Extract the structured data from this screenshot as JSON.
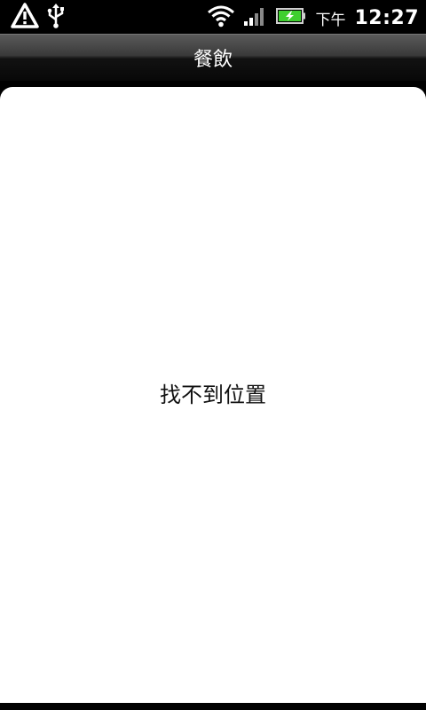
{
  "status_bar": {
    "clock_ampm": "下午",
    "clock_time": "12:27",
    "icons": [
      "warning-icon",
      "usb-icon",
      "wifi-icon",
      "signal-icon",
      "battery-charging-icon"
    ],
    "battery_color": "#3fcf2f"
  },
  "header": {
    "title": "餐飲"
  },
  "main": {
    "empty_message": "找不到位置"
  }
}
